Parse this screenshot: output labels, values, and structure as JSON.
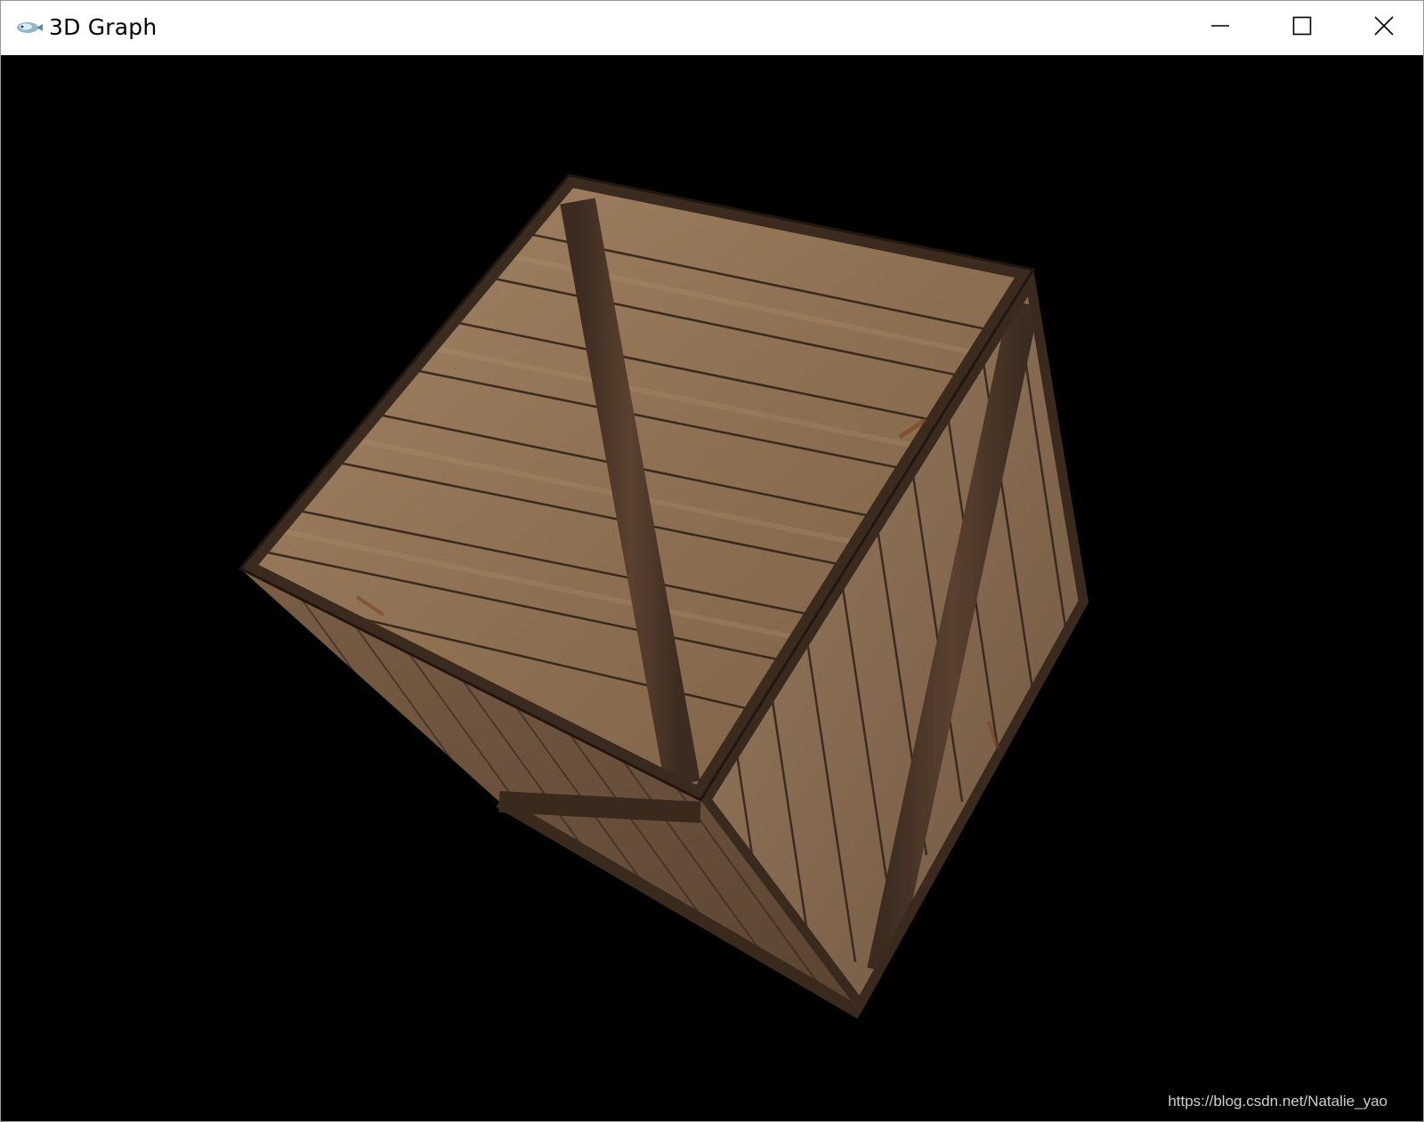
{
  "window": {
    "title": "3D Graph",
    "icon": "opengl-app-icon",
    "controls": {
      "minimize": "minimize-icon",
      "maximize": "maximize-icon",
      "close": "close-icon"
    }
  },
  "scene": {
    "background": "#000000",
    "object": "textured wooden crate cube",
    "texture_colors": {
      "wood_light": "#9a7c5e",
      "wood_dark": "#5e4532",
      "frame_dark": "#3a2a1e",
      "rust": "#6b3e22"
    }
  },
  "watermark": {
    "text": "https://blog.csdn.net/Natalie_yao"
  }
}
